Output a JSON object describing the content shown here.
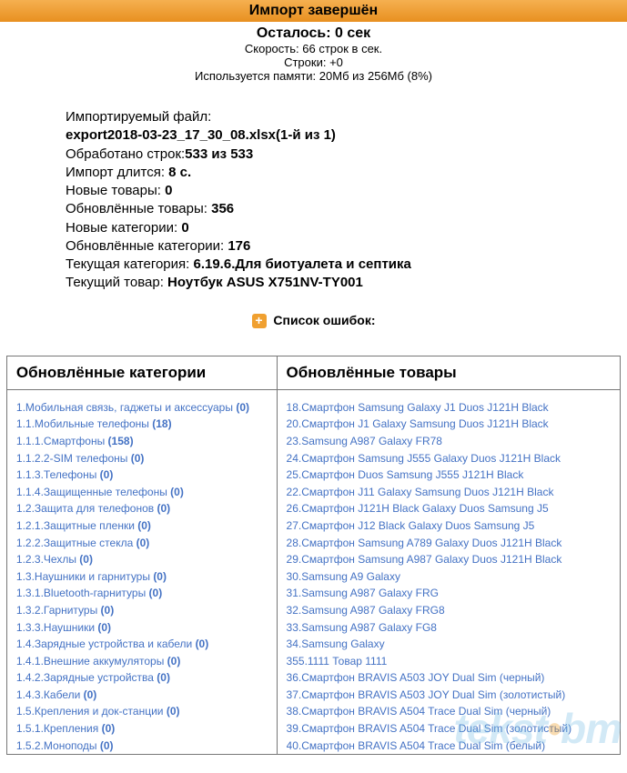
{
  "title": "Импорт завершён",
  "summary": {
    "remaining_label": "Осталось:",
    "remaining_value": "0 сек",
    "speed_label": "Скорость:",
    "speed_value": "66 строк в сек.",
    "rows_label": "Строки:",
    "rows_value": "+0",
    "memory_label": "Используется памяти:",
    "memory_value": "20Мб из 256Мб (8%)"
  },
  "details": {
    "file_label": "Импортируемый файл:",
    "file_value": "export2018-03-23_17_30_08.xlsx(1-й из 1)",
    "processed_label": "Обработано строк:",
    "processed_value": "533 из 533",
    "duration_label": "Импорт длится:",
    "duration_value": "8 с.",
    "new_prod_label": "Новые товары:",
    "new_prod_value": "0",
    "upd_prod_label": "Обновлённые товары:",
    "upd_prod_value": "356",
    "new_cat_label": "Новые категории:",
    "new_cat_value": "0",
    "upd_cat_label": "Обновлённые категории:",
    "upd_cat_value": "176",
    "cur_cat_label": "Текущая категория:",
    "cur_cat_value": "6.19.6.Для биотуалета и септика",
    "cur_prod_label": "Текущий товар:",
    "cur_prod_value": "Ноутбук ASUS X751NV-TY001"
  },
  "errors_label": "Список ошибок:",
  "headers": {
    "updated_categories": "Обновлённые категории",
    "updated_products": "Обновлённые товары"
  },
  "categories": [
    {
      "path": "1.Мобильная связь, гаджеты и аксессуары",
      "count": "(0)"
    },
    {
      "path": "1.1.Мобильные телефоны",
      "count": "(18)"
    },
    {
      "path": "1.1.1.Смартфоны",
      "count": "(158)"
    },
    {
      "path": "1.1.2.2-SIM телефоны",
      "count": "(0)"
    },
    {
      "path": "1.1.3.Телефоны",
      "count": "(0)"
    },
    {
      "path": "1.1.4.Защищенные телефоны",
      "count": "(0)"
    },
    {
      "path": "1.2.Защита для телефонов",
      "count": "(0)"
    },
    {
      "path": "1.2.1.Защитные пленки",
      "count": "(0)"
    },
    {
      "path": "1.2.2.Защитные стекла",
      "count": "(0)"
    },
    {
      "path": "1.2.3.Чехлы",
      "count": "(0)"
    },
    {
      "path": "1.3.Наушники и гарнитуры",
      "count": "(0)"
    },
    {
      "path": "1.3.1.Bluetooth-гарнитуры",
      "count": "(0)"
    },
    {
      "path": "1.3.2.Гарнитуры",
      "count": "(0)"
    },
    {
      "path": "1.3.3.Наушники",
      "count": "(0)"
    },
    {
      "path": "1.4.Зарядные устройства и кабели",
      "count": "(0)"
    },
    {
      "path": "1.4.1.Внешние аккумуляторы",
      "count": "(0)"
    },
    {
      "path": "1.4.2.Зарядные устройства",
      "count": "(0)"
    },
    {
      "path": "1.4.3.Кабели",
      "count": "(0)"
    },
    {
      "path": "1.5.Крепления и док-станции",
      "count": "(0)"
    },
    {
      "path": "1.5.1.Крепления",
      "count": "(0)"
    },
    {
      "path": "1.5.2.Моноподы",
      "count": "(0)"
    }
  ],
  "products": [
    {
      "id": "18",
      "name": "Смартфон Samsung Galaxy J1 Duos J121H Black"
    },
    {
      "id": "20",
      "name": "Смартфон J1 Galaxy Samsung Duos J121H Black"
    },
    {
      "id": "23",
      "name": "Samsung A987 Galaxy FR78"
    },
    {
      "id": "24",
      "name": "Смартфон Samsung J555 Galaxy Duos J121H Black"
    },
    {
      "id": "25",
      "name": "Смартфон Duos Samsung J555 J121H Black"
    },
    {
      "id": "22",
      "name": "Смартфон J11 Galaxy Samsung Duos J121H Black"
    },
    {
      "id": "26",
      "name": "Смартфон J121H Black Galaxy Duos Samsung J5"
    },
    {
      "id": "27",
      "name": "Смартфон J12 Black Galaxy Duos Samsung J5"
    },
    {
      "id": "28",
      "name": "Смартфон Samsung A789 Galaxy Duos J121H Black"
    },
    {
      "id": "29",
      "name": "Смартфон Samsung A987 Galaxy Duos J121H Black"
    },
    {
      "id": "30",
      "name": "Samsung A9 Galaxy"
    },
    {
      "id": "31",
      "name": "Samsung A987 Galaxy FRG"
    },
    {
      "id": "32",
      "name": "Samsung A987 Galaxy FRG8"
    },
    {
      "id": "33",
      "name": "Samsung A987 Galaxy FG8"
    },
    {
      "id": "34",
      "name": "Samsung Galaxy"
    },
    {
      "id": "355",
      "name": "1111 Товар 1111"
    },
    {
      "id": "36",
      "name": "Смартфон BRAVIS A503 JOY Dual Sim (черный)"
    },
    {
      "id": "37",
      "name": "Смартфон BRAVIS A503 JOY Dual Sim (золотистый)"
    },
    {
      "id": "38",
      "name": "Смартфон BRAVIS A504 Trace Dual Sim (черный)"
    },
    {
      "id": "39",
      "name": "Смартфон BRAVIS A504 Trace Dual Sim (золотистый)"
    },
    {
      "id": "40",
      "name": "Смартфон BRAVIS A504 Trace Dual Sim (белый)"
    }
  ],
  "watermark": {
    "text1": "tekst",
    "dot": "•",
    "text2": "bm"
  }
}
